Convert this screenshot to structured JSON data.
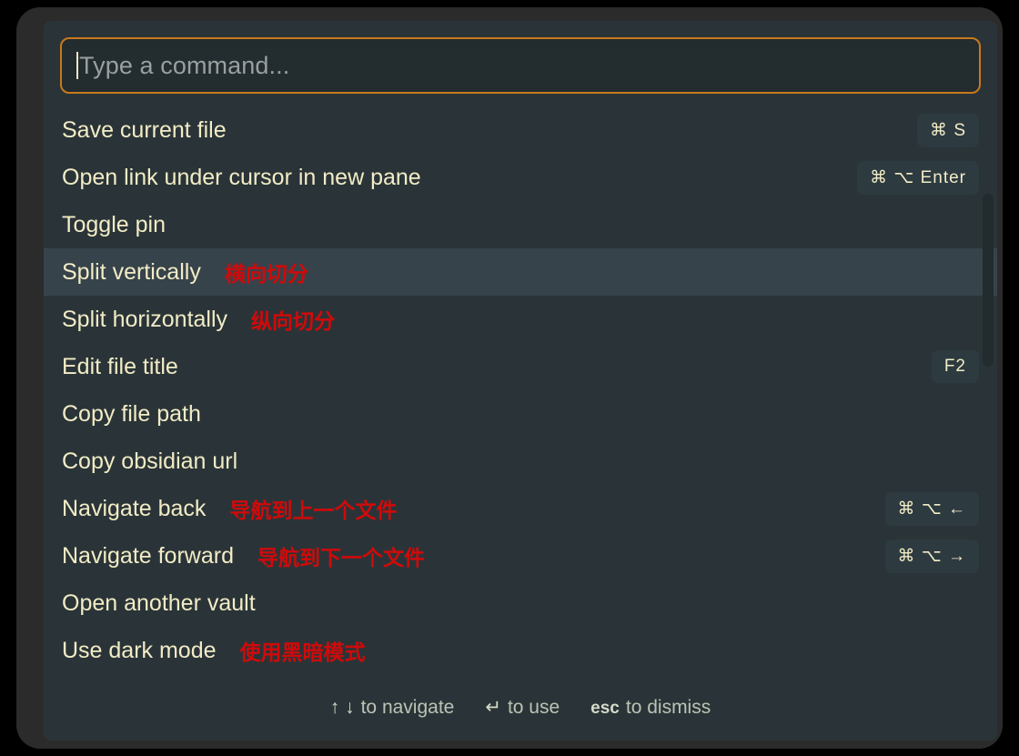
{
  "search": {
    "placeholder": "Type a command...",
    "value": "",
    "border_color": "#c8791c"
  },
  "theme": {
    "modal_bg": "#2a3438",
    "selected_row_bg": "#37434b",
    "text_color": "#f2ecc6",
    "annotation_color": "#d00a0a",
    "badge_bg": "#2d3a40",
    "footer_color": "#bcc3b4"
  },
  "commands": [
    {
      "label": "Save current file",
      "annotation": "",
      "hotkey": "⌘ S",
      "selected": false
    },
    {
      "label": "Open link under cursor in new pane",
      "annotation": "",
      "hotkey": "⌘ ⌥ Enter",
      "selected": false
    },
    {
      "label": "Toggle pin",
      "annotation": "",
      "hotkey": "",
      "selected": false
    },
    {
      "label": "Split vertically",
      "annotation": "横向切分",
      "hotkey": "",
      "selected": true
    },
    {
      "label": "Split horizontally",
      "annotation": "纵向切分",
      "hotkey": "",
      "selected": false
    },
    {
      "label": "Edit file title",
      "annotation": "",
      "hotkey": "F2",
      "selected": false
    },
    {
      "label": "Copy file path",
      "annotation": "",
      "hotkey": "",
      "selected": false
    },
    {
      "label": "Copy obsidian url",
      "annotation": "",
      "hotkey": "",
      "selected": false
    },
    {
      "label": "Navigate back",
      "annotation": "导航到上一个文件",
      "hotkey": "⌘ ⌥ ←",
      "selected": false
    },
    {
      "label": "Navigate forward",
      "annotation": "导航到下一个文件",
      "hotkey": "⌘ ⌥ →",
      "selected": false
    },
    {
      "label": "Open another vault",
      "annotation": "",
      "hotkey": "",
      "selected": false
    },
    {
      "label": "Use dark mode",
      "annotation": "使用黑暗模式",
      "hotkey": "",
      "selected": false
    }
  ],
  "footer": {
    "hints": [
      {
        "key": "↑ ↓",
        "text": "to navigate",
        "bold": false
      },
      {
        "key": "↵",
        "text": "to use",
        "bold": false
      },
      {
        "key": "esc",
        "text": "to dismiss",
        "bold": true
      }
    ]
  }
}
